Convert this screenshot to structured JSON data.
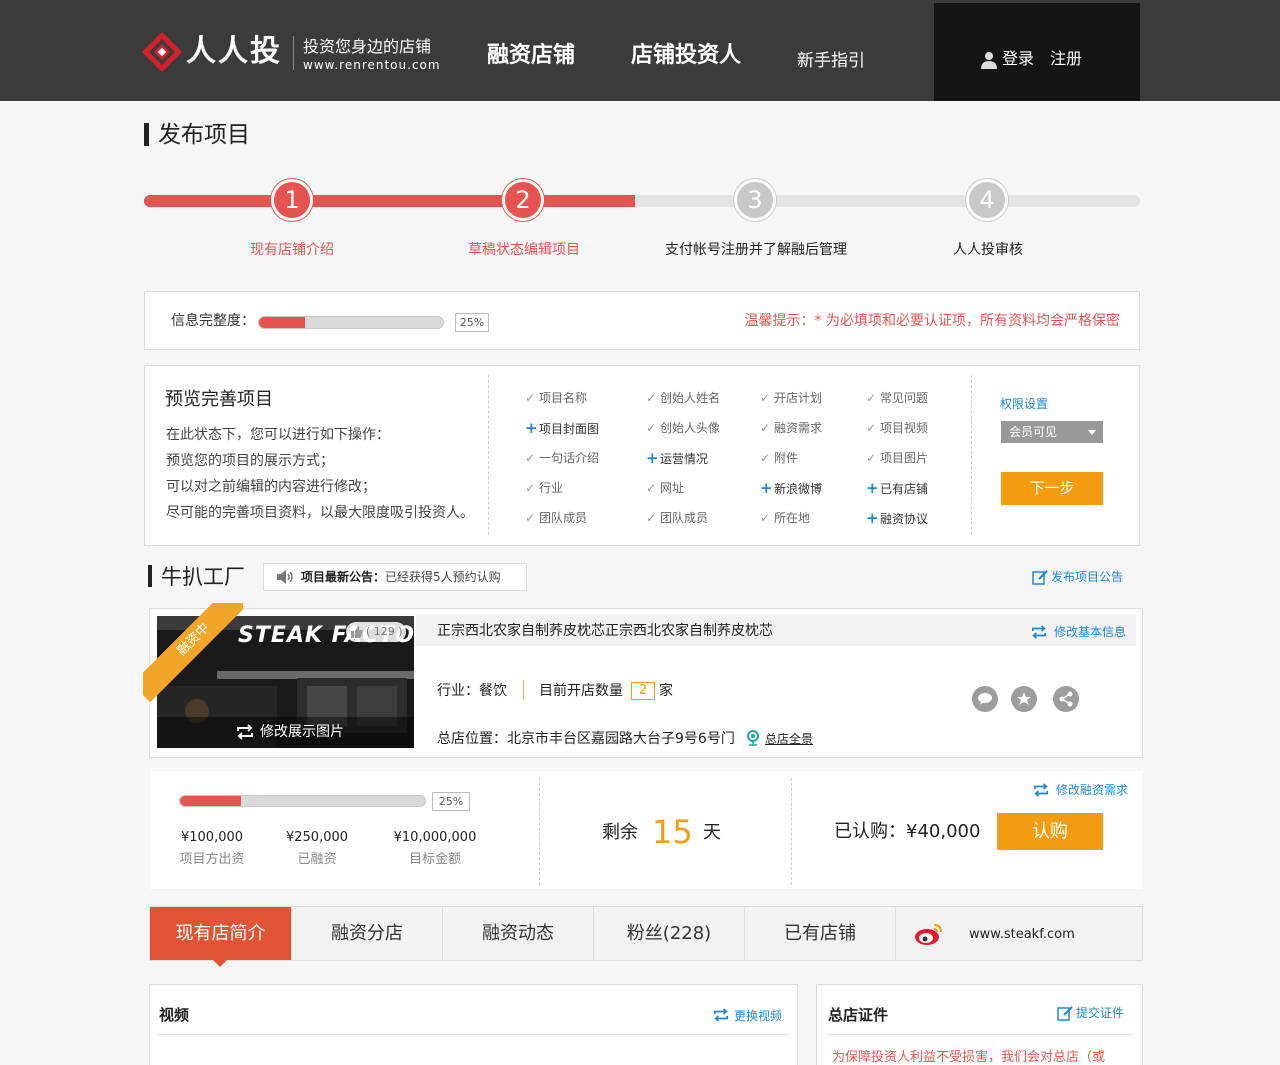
{
  "header": {
    "brand": "人人投",
    "slogan": "投资您身边的店铺",
    "domain": "www.renrentou.com",
    "nav": [
      "融资店铺",
      "店铺投资人",
      "新手指引"
    ],
    "login": "登录",
    "register": "注册"
  },
  "page_title": "发布项目",
  "steps": [
    {
      "num": "1",
      "label": "现有店铺介绍",
      "done": true
    },
    {
      "num": "2",
      "label": "草稿状态编辑项目",
      "done": true
    },
    {
      "num": "3",
      "label": "支付帐号注册并了解融后管理",
      "done": false
    },
    {
      "num": "4",
      "label": "人人投审核",
      "done": false
    }
  ],
  "completeness": {
    "label": "信息完整度：",
    "percent_text": "25%",
    "percent": 0.25,
    "tip": "温馨提示：* 为必填项和必要认证项，所有资料均会严格保密"
  },
  "preview": {
    "title": "预览完善项目",
    "lines": [
      "在此状态下，您可以进行如下操作：",
      "预览您的项目的展示方式；",
      "可以对之前编辑的内容进行修改；",
      "尽可能的完善项目资料，以最大限度吸引投资人。"
    ],
    "columns": [
      [
        {
          "m": "check",
          "t": "项目名称"
        },
        {
          "m": "plus",
          "t": "项目封面图"
        },
        {
          "m": "check",
          "t": "一句话介绍"
        },
        {
          "m": "check",
          "t": "行业"
        },
        {
          "m": "check",
          "t": "团队成员"
        }
      ],
      [
        {
          "m": "check",
          "t": "创始人姓名"
        },
        {
          "m": "check",
          "t": "创始人头像"
        },
        {
          "m": "plus",
          "t": "运营情况"
        },
        {
          "m": "check",
          "t": "网址"
        },
        {
          "m": "check",
          "t": "团队成员"
        }
      ],
      [
        {
          "m": "check",
          "t": "开店计划"
        },
        {
          "m": "check",
          "t": "融资需求"
        },
        {
          "m": "check",
          "t": "附件"
        },
        {
          "m": "plus",
          "t": "新浪微博"
        },
        {
          "m": "check",
          "t": "所在地"
        }
      ],
      [
        {
          "m": "check",
          "t": "常见问题"
        },
        {
          "m": "check",
          "t": "项目视频"
        },
        {
          "m": "check",
          "t": "项目图片"
        },
        {
          "m": "plus",
          "t": "已有店铺"
        },
        {
          "m": "plus",
          "t": "融资协议"
        }
      ]
    ],
    "permission_label": "权限设置",
    "permission_value": "会员可见",
    "next": "下一步"
  },
  "project": {
    "name": "牛扒工厂",
    "notice_label": "项目最新公告：",
    "notice": "已经获得5人预约认购",
    "publish_notice": "发布项目公告",
    "status_ribbon": "融资中",
    "cover_title": "STEAK FACTORY",
    "likes": "( 129 )",
    "edit_image": "修改展示图片",
    "description": "正宗西北农家自制荞皮枕芯正宗西北农家自制荞皮枕芯",
    "edit_basic": "修改基本信息",
    "industry": "行业：餐饮",
    "stores_label": "目前开店数量",
    "stores_count": "2",
    "stores_unit": "家",
    "address": "总店位置：北京市丰台区嘉园路大台子9号6号门",
    "panorama": "总店全景"
  },
  "funding": {
    "percent_text": "25%",
    "percent": 0.25,
    "amounts": [
      {
        "value": "¥100,000",
        "label": "项目方出资"
      },
      {
        "value": "¥250,000",
        "label": "已融资"
      },
      {
        "value": "¥10,000,000",
        "label": "目标金额"
      }
    ],
    "remain_label": "剩余",
    "remain_days": "15",
    "remain_unit": "天",
    "edit_need": "修改融资需求",
    "subscribed": "已认购：¥40,000",
    "subscribe_button": "认购"
  },
  "tabs": [
    "现有店简介",
    "融资分店",
    "融资动态",
    "粉丝(228)",
    "已有店铺"
  ],
  "website": "www.steakf.com",
  "video_panel": {
    "title": "视频",
    "action": "更换视频"
  },
  "cert_panel": {
    "title": "总店证件",
    "action": "提交证件",
    "text": "为保障投资人利益不受损害，我们会对总店（或"
  },
  "colors": {
    "accent": "#e55451",
    "orange": "#f39c12",
    "link": "#1e88d6",
    "header": "#3b3b3b"
  }
}
